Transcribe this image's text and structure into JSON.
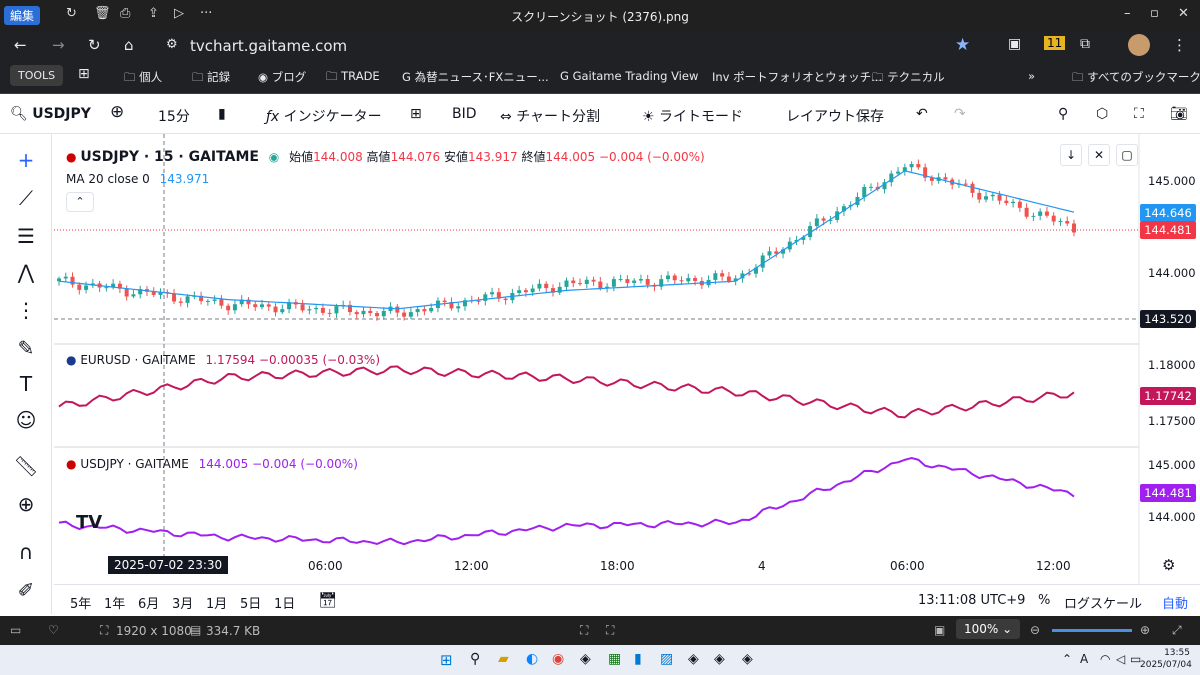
{
  "window": {
    "title": "スクリーンショット (2376).png",
    "edit_label": "編集"
  },
  "browser": {
    "url": "tvchart.gaitame.com"
  },
  "bookmarks": [
    {
      "label": "TOOLS"
    },
    {
      "label": "個人"
    },
    {
      "label": "記録"
    },
    {
      "label": "ブログ"
    },
    {
      "label": "TRADE"
    },
    {
      "label": "為替ニュース･FXニュー..."
    },
    {
      "label": "Gaitame Trading View"
    },
    {
      "label": "ポートフォリオとウォッチ..."
    },
    {
      "label": "テクニカル"
    },
    {
      "label": "すべてのブックマーク"
    }
  ],
  "toolbar": {
    "symbol": "USDJPY",
    "interval": "15分",
    "indicators": "インジケーター",
    "bid": "BID",
    "split": "チャート分割",
    "lightmode": "ライトモード",
    "save_layout": "レイアウト保存"
  },
  "main_legend": {
    "title": "USDJPY · 15 · GAITAME",
    "open_label": "始値",
    "open": "144.008",
    "high_label": "高値",
    "high": "144.076",
    "low_label": "安値",
    "low": "143.917",
    "close_label": "終値",
    "close": "144.005",
    "change": "−0.004 (−0.00%)",
    "ma_label": "MA 20 close 0",
    "ma_value": "143.971"
  },
  "eur_legend": {
    "title": "EURUSD · GAITAME",
    "value": "1.17594",
    "change": "−0.00035 (−0.03%)"
  },
  "usd_legend": {
    "title": "USDJPY · GAITAME",
    "value": "144.005",
    "change": "−0.004 (−0.00%)"
  },
  "price_axis": {
    "main_ticks": [
      "145.000",
      "144.000"
    ],
    "ma_tag": "144.646",
    "price_tag": "144.481",
    "crosshair_tag": "143.520",
    "eur_ticks": [
      "1.18000",
      "1.17500"
    ],
    "eur_tag": "1.17742",
    "usd_ticks": [
      "145.000",
      "144.000"
    ],
    "usd_tag": "144.481"
  },
  "time_axis": {
    "cursor_label": "2025-07-02   23:30",
    "labels": [
      "06:00",
      "12:00",
      "18:00",
      "4",
      "06:00",
      "12:00"
    ]
  },
  "bottom": {
    "ranges": [
      "5年",
      "1年",
      "6月",
      "3月",
      "1月",
      "5日",
      "1日"
    ],
    "clock": "13:11:08 UTC+9",
    "percent": "%",
    "log": "ログスケール",
    "auto": "自動"
  },
  "viewer": {
    "dimensions": "1920 x 1080",
    "size": "334.7 KB",
    "zoom": "100%"
  },
  "taskbar": {
    "time": "13:55",
    "date": "2025/07/04"
  },
  "colors": {
    "up": "#26a69a",
    "down": "#ef5350",
    "ma": "#2196f3",
    "eur": "#c2185b",
    "usd": "#a020f0"
  },
  "chart_data": {
    "type": "line",
    "title": "USDJPY · 15 · GAITAME",
    "x": [
      "2025-07-02 21:00",
      "2025-07-03 06:00",
      "2025-07-03 12:00",
      "2025-07-03 18:00",
      "2025-07-04 00:00",
      "2025-07-04 06:00",
      "2025-07-04 12:00"
    ],
    "series": [
      {
        "name": "USDJPY",
        "values": [
          143.9,
          143.65,
          143.55,
          143.87,
          143.93,
          145.15,
          144.48
        ]
      },
      {
        "name": "MA 20 close 0",
        "values": [
          143.9,
          143.7,
          143.6,
          143.8,
          143.9,
          145.1,
          144.65
        ]
      },
      {
        "name": "EURUSD",
        "values": [
          1.1762,
          1.1788,
          1.1795,
          1.1787,
          1.1775,
          1.1755,
          1.1774
        ]
      }
    ],
    "ylim": [
      143.4,
      145.3
    ],
    "grid": false,
    "legend": "top-left"
  }
}
